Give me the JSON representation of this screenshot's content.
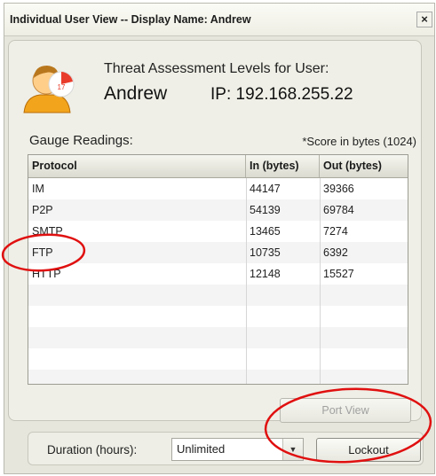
{
  "window": {
    "title": "Individual User View -- Display Name:  Andrew",
    "close_glyph": "×"
  },
  "header": {
    "avatar_badge": "17",
    "threat_label": "Threat Assessment Levels for User:",
    "user_name": "Andrew",
    "ip_text": "IP: 192.168.255.22"
  },
  "gauge": {
    "label": "Gauge Readings:",
    "score_note": "*Score in bytes (1024)",
    "columns": [
      "Protocol",
      "In (bytes)",
      "Out (bytes)"
    ],
    "rows": [
      {
        "protocol": "IM",
        "in": "44147",
        "out": "39366"
      },
      {
        "protocol": "P2P",
        "in": "54139",
        "out": "69784"
      },
      {
        "protocol": "SMTP",
        "in": "13465",
        "out": "7274"
      },
      {
        "protocol": "FTP",
        "in": "10735",
        "out": "6392"
      },
      {
        "protocol": "HTTP",
        "in": "12148",
        "out": "15527"
      }
    ]
  },
  "buttons": {
    "port_view": "Port View",
    "lockout": "Lockout"
  },
  "duration": {
    "label": "Duration (hours):",
    "value": "Unlimited",
    "arrow_glyph": "▼"
  },
  "colors": {
    "annotation": "#e01010",
    "window_bg": "#e6e6dc"
  }
}
